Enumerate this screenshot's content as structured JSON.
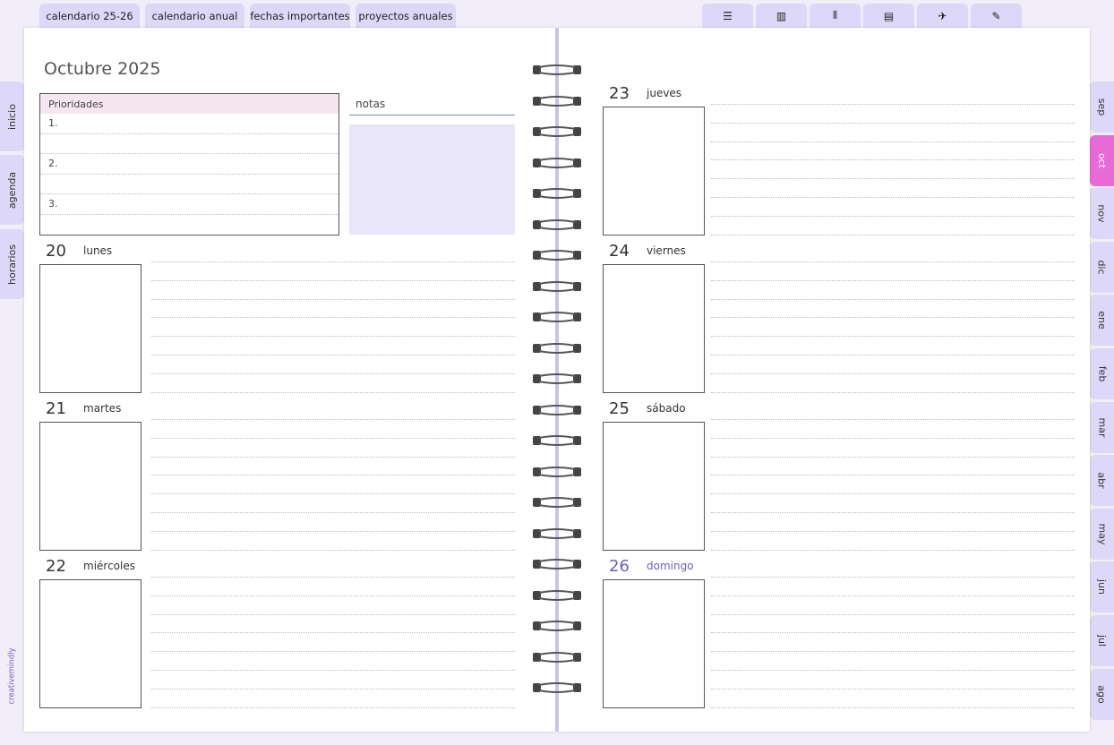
{
  "top_tabs": [
    "calendario 25-26",
    "calendario anual",
    "fechas importantes",
    "proyectos anuales"
  ],
  "top_icon_tabs": [
    "list-icon",
    "bar-chart-icon",
    "utensils-icon",
    "notebook-icon",
    "plane-icon",
    "pencil-icon"
  ],
  "icon_glyphs": {
    "list-icon": "☰",
    "bar-chart-icon": "▥",
    "utensils-icon": "⫴",
    "notebook-icon": "▤",
    "plane-icon": "✈",
    "pencil-icon": "✎"
  },
  "left_tabs": [
    "inicio",
    "agenda",
    "horarios"
  ],
  "month_tabs": [
    "sep",
    "oct",
    "nov",
    "dic",
    "ene",
    "feb",
    "mar",
    "abr",
    "may",
    "jun",
    "jul",
    "ago"
  ],
  "active_month": "oct",
  "brand": "creativemindly",
  "month_title": "Octubre 2025",
  "priorities": {
    "header": "Prioridades",
    "items": [
      "1.",
      "",
      "2.",
      "",
      "3.",
      ""
    ]
  },
  "notes_label": "notas",
  "days": {
    "mon": {
      "num": "20",
      "name": "lunes"
    },
    "tue": {
      "num": "21",
      "name": "martes"
    },
    "wed": {
      "num": "22",
      "name": "miércoles"
    },
    "thu": {
      "num": "23",
      "name": "jueves"
    },
    "fri": {
      "num": "24",
      "name": "viernes"
    },
    "sat": {
      "num": "25",
      "name": "sábado"
    },
    "sun": {
      "num": "26",
      "name": "domingo"
    }
  },
  "colors": {
    "tab": "#ddd8f7",
    "active_tab": "#e86ad8",
    "notes_fill": "#e8e6f8",
    "sunday": "#6a5fc4"
  }
}
